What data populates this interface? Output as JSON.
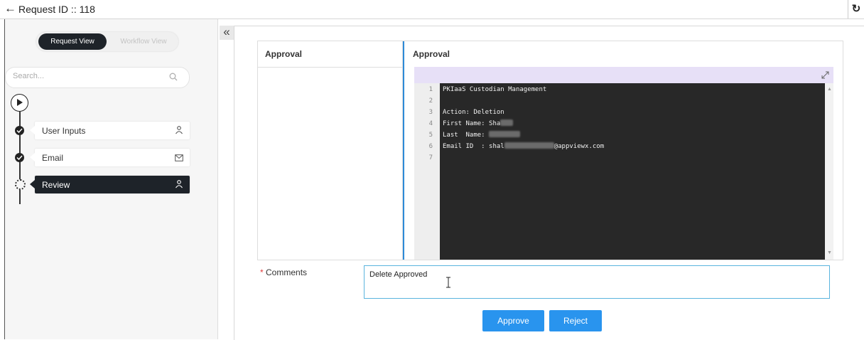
{
  "header": {
    "title": "Request ID :: 118",
    "back_icon": "arrow-left-icon",
    "refresh_icon": "refresh-icon"
  },
  "sidebar": {
    "view_tabs": [
      "Request View",
      "Workflow View"
    ],
    "search_placeholder": "Search...",
    "steps": [
      {
        "label": "User Inputs",
        "status": "completed",
        "icon": "user-icon"
      },
      {
        "label": "Email",
        "status": "completed",
        "icon": "envelope-icon"
      },
      {
        "label": "Review",
        "status": "current",
        "icon": "user-icon"
      }
    ]
  },
  "main": {
    "left_tab": "Approval",
    "panel_title": "Approval",
    "editor": {
      "line_numbers": [
        "1",
        "2",
        "3",
        "4",
        "5",
        "6",
        "7"
      ],
      "lines": [
        {
          "text": "PKIaaS Custodian Management"
        },
        {
          "text": ""
        },
        {
          "text": "Action: Deletion"
        },
        {
          "text": "First Name: Sha",
          "redacted_after": true
        },
        {
          "text": "Last  Name: ",
          "redacted_after": true
        },
        {
          "text": "Email ID  : shal",
          "redacted_middle": true,
          "suffix": "@appviewx.com"
        },
        {
          "text": ""
        }
      ]
    },
    "comments_label": "Comments",
    "comments_required_marker": "*",
    "comments_value": "Delete Approved",
    "approve_label": "Approve",
    "reject_label": "Reject",
    "colors": {
      "accent": "#2994ee",
      "dark": "#1e2329",
      "editor_bg": "#282828",
      "editor_header": "#e7e0f7"
    }
  }
}
